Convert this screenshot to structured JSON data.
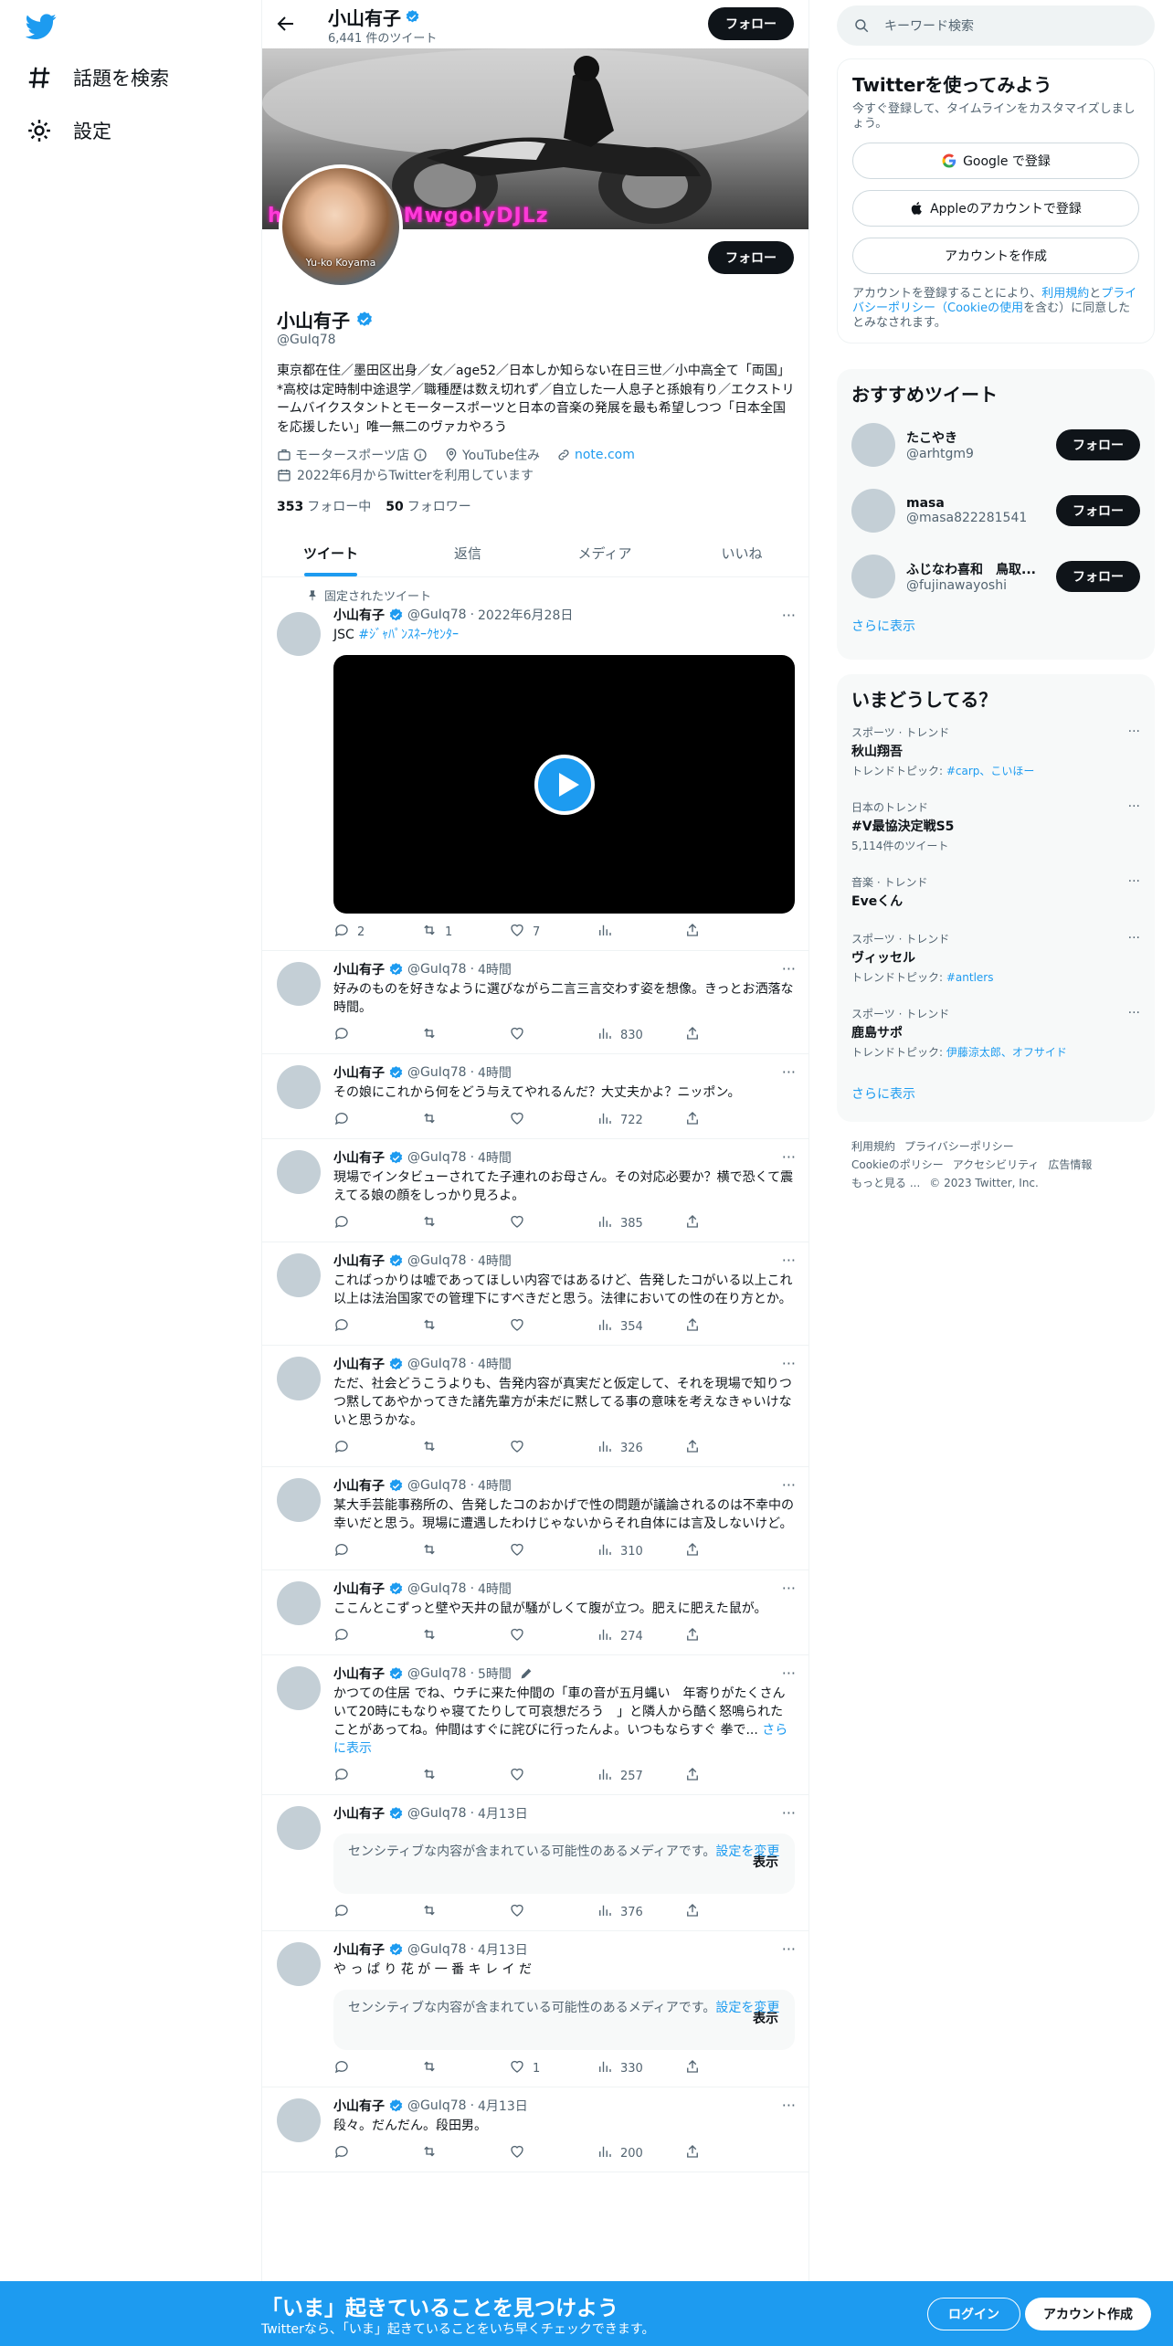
{
  "nav": {
    "items": [
      {
        "label": "話題を検索",
        "icon": "hash-icon"
      },
      {
        "label": "設定",
        "icon": "gear-icon"
      }
    ]
  },
  "topbar": {
    "name": "小山有子",
    "tweet_count": "6,441 件のツイート",
    "follow_label": "フォロー"
  },
  "banner": {
    "overlay_text": "h............OMwgoIyDJLz"
  },
  "profile": {
    "avatar_caption": "Yu-ko Koyama",
    "name": "小山有子",
    "handle": "@GuIq78",
    "bio": "東京都在住／墨田区出身／女／age52／日本しか知らない在日三世／小中高全て「両国」*高校は定時制中途退学／職種歴は数え切れず／自立した一人息子と孫娘有り／エクストリームバイクスタントとモータースポーツと日本の音楽の発展を最も希望しつつ「日本全国を応援したい」唯一無二のヴァカやろう",
    "category": "モータースポーツ店",
    "location": "YouTube住み",
    "url": "note.com",
    "joined": "2022年6月からTwitterを利用しています",
    "following_count": "353",
    "following_label": "フォロー中",
    "followers_count": "50",
    "followers_label": "フォロワー",
    "follow_label": "フォロー"
  },
  "tabs": [
    "ツイート",
    "返信",
    "メディア",
    "いいね"
  ],
  "tweets": [
    {
      "pinned_label": "固定されたツイート",
      "name": "小山有子",
      "handle": "@GuIq78",
      "time": "2022年6月28日",
      "text_prefix": "JSC ",
      "hashtag": "#ｼﾞｬﾊﾟﾝｽﾈｰｸｾﾝﾀｰ",
      "reply": "2",
      "retweet": "1",
      "like": "7",
      "views": ""
    },
    {
      "name": "小山有子",
      "handle": "@GuIq78",
      "time": "4時間",
      "text": "好みのものを好きなように選びながら二言三言交わす姿を想像。きっとお洒落な時間。",
      "reply": "",
      "retweet": "",
      "like": "",
      "views": "830"
    },
    {
      "name": "小山有子",
      "handle": "@GuIq78",
      "time": "4時間",
      "text": "その娘にこれから何をどう与えてやれるんだ？大丈夫かよ？ニッポン。",
      "reply": "",
      "retweet": "",
      "like": "",
      "views": "722"
    },
    {
      "name": "小山有子",
      "handle": "@GuIq78",
      "time": "4時間",
      "text": "現場でインタビューされてた子連れのお母さん。その対応必要か？横で恐くて震えてる娘の顔をしっかり見ろよ。",
      "reply": "",
      "retweet": "",
      "like": "",
      "views": "385"
    },
    {
      "name": "小山有子",
      "handle": "@GuIq78",
      "time": "4時間",
      "text": "こればっかりは嘘であってほしい内容ではあるけど、告発したコがいる以上これ以上は法治国家での管理下にすべきだと思う。法律においての性の在り方とか。",
      "reply": "",
      "retweet": "",
      "like": "",
      "views": "354"
    },
    {
      "name": "小山有子",
      "handle": "@GuIq78",
      "time": "4時間",
      "text": "ただ、社会どうこうよりも、告発内容が真実だと仮定して、それを現場で知りつつ黙してあやかってきた諸先輩方が未だに黙してる事の意味を考えなきゃいけないと思うかな。",
      "reply": "",
      "retweet": "",
      "like": "",
      "views": "326"
    },
    {
      "name": "小山有子",
      "handle": "@GuIq78",
      "time": "4時間",
      "text": "某大手芸能事務所の、告発したコのおかげで性の問題が議論されるのは不幸中の幸いだと思う。現場に遭遇したわけじゃないからそれ自体には言及しないけど。",
      "reply": "",
      "retweet": "",
      "like": "",
      "views": "310"
    },
    {
      "name": "小山有子",
      "handle": "@GuIq78",
      "time": "4時間",
      "text": "ここんとこずっと壁や天井の鼠が騒がしくて腹が立つ。肥えに肥えた鼠が。",
      "reply": "",
      "retweet": "",
      "like": "",
      "views": "274"
    },
    {
      "name": "小山有子",
      "handle": "@GuIq78",
      "time": "5時間",
      "text": "かつての住居 でね、ウチに来た仲間の「車の音が五月蝿い　年寄りがたくさんいて20時にもなりゃ寝てたりして可哀想だろう　」と隣人から酷く怒鳴られたことがあってね。仲間はすぐに詫びに行ったんよ。いつもならすぐ 拳で...",
      "show_more": "さらに表示",
      "reply": "",
      "retweet": "",
      "like": "",
      "views": "257"
    },
    {
      "name": "小山有子",
      "handle": "@GuIq78",
      "time": "4月13日",
      "sensitive_text": "センシティブな内容が含まれている可能性のあるメディアです。",
      "sensitive_link": "設定を変更",
      "sensitive_show": "表示",
      "reply": "",
      "retweet": "",
      "like": "",
      "views": "376"
    },
    {
      "name": "小山有子",
      "handle": "@GuIq78",
      "time": "4月13日",
      "text": "や っ ぱ り 花 が 一 番 キ レ イ だ",
      "sensitive_text": "センシティブな内容が含まれている可能性のあるメディアです。",
      "sensitive_link": "設定を変更",
      "sensitive_show": "表示",
      "reply": "",
      "retweet": "",
      "like": "1",
      "views": "330"
    },
    {
      "name": "小山有子",
      "handle": "@GuIq78",
      "time": "4月13日",
      "text": "段々。だんだん。段田男。",
      "reply": "",
      "retweet": "",
      "like": "",
      "views": "200"
    }
  ],
  "sidebar": {
    "search_placeholder": "キーワード検索",
    "signup": {
      "title": "Twitterを使ってみよう",
      "subtitle": "今すぐ登録して、タイムラインをカスタマイズしましょう。",
      "google": "Google で登録",
      "apple": "Appleのアカウントで登録",
      "create": "アカウントを作成",
      "legal_prefix": "アカウントを登録することにより、",
      "legal_terms": "利用規約",
      "legal_and": "と",
      "legal_privacy": "プライバシーポリシー（Cookieの使用",
      "legal_suffix": "を含む）に同意したとみなされます。"
    },
    "recommend": {
      "title": "おすすめツイート",
      "users": [
        {
          "name": "たこやき",
          "handle": "@arhtgm9"
        },
        {
          "name": "masa",
          "handle": "@masa822281541"
        },
        {
          "name": "ふじなわ喜和　鳥取...",
          "handle": "@fujinawayoshi"
        }
      ],
      "follow_label": "フォロー",
      "show_more": "さらに表示"
    },
    "trends": {
      "title": "いまどうしてる？",
      "items": [
        {
          "category": "スポーツ · トレンド",
          "topic": "秋山翔吾",
          "extra_label": "トレンドトピック: ",
          "extra_link": "#carp、こいほー"
        },
        {
          "category": "日本のトレンド",
          "topic": "#V最協決定戦S5",
          "extra_label": "5,114件のツイート",
          "extra_link": ""
        },
        {
          "category": "音楽 · トレンド",
          "topic": "Eveくん",
          "extra_label": "",
          "extra_link": ""
        },
        {
          "category": "スポーツ · トレンド",
          "topic": "ヴィッセル",
          "extra_label": "トレンドトピック: ",
          "extra_link": "#antlers"
        },
        {
          "category": "スポーツ · トレンド",
          "topic": "鹿島サポ",
          "extra_label": "トレンドトピック: ",
          "extra_link": "伊藤涼太郎、オフサイド"
        }
      ],
      "show_more": "さらに表示"
    },
    "footer": {
      "links": [
        "利用規約",
        "プライバシーポリシー",
        "Cookieのポリシー",
        "アクセシビリティ",
        "広告情報",
        "もっと見る ..."
      ],
      "copyright": "© 2023 Twitter, Inc."
    }
  },
  "bottom_bar": {
    "title": "「いま」起きていることを見つけよう",
    "subtitle": "Twitterなら、「いま」起きていることをいち早くチェックできます。",
    "login": "ログイン",
    "signup": "アカウント作成"
  },
  "colors": {
    "accent": "#1d9bf0",
    "text": "#0f1419",
    "muted": "#536471",
    "banner_text": "#ff3ad8"
  }
}
